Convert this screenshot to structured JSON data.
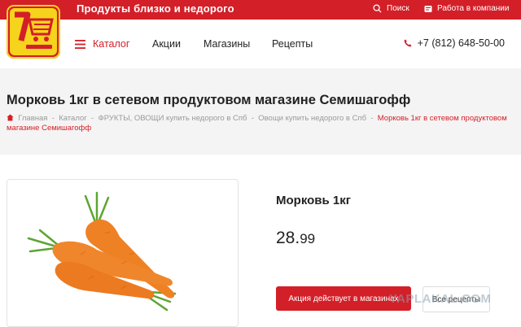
{
  "header": {
    "tagline": "Продукты близко и недорого",
    "search_label": "Поиск",
    "search_icon": "search-icon",
    "jobs_label": "Работа в компании",
    "jobs_icon": "document-icon",
    "brand_color": "#d31f28",
    "logo_color": "#f6d31c"
  },
  "nav": {
    "catalog_label": "Каталог",
    "items": [
      "Акции",
      "Магазины",
      "Рецепты"
    ],
    "phone": "+7 (812) 648-50-00",
    "phone_icon": "phone-icon"
  },
  "page": {
    "title": "Морковь 1кг в сетевом продуктовом магазине Семишагофф",
    "breadcrumbs": [
      "Главная",
      "Каталог",
      "ФРУКТЫ, ОВОЩИ купить недорого в Спб",
      "Овощи купить недорого в Спб"
    ],
    "breadcrumb_current": "Морковь 1кг в сетевом продуктовом магазине Семишагофф",
    "separator": "-"
  },
  "product": {
    "name": "Морковь 1кг",
    "price_main": "28.",
    "price_cents": "99",
    "promo_button": "Акция действует в магазинах",
    "recipe_button": "Все рецепты"
  },
  "watermark": "YAPLAKAL.COM"
}
